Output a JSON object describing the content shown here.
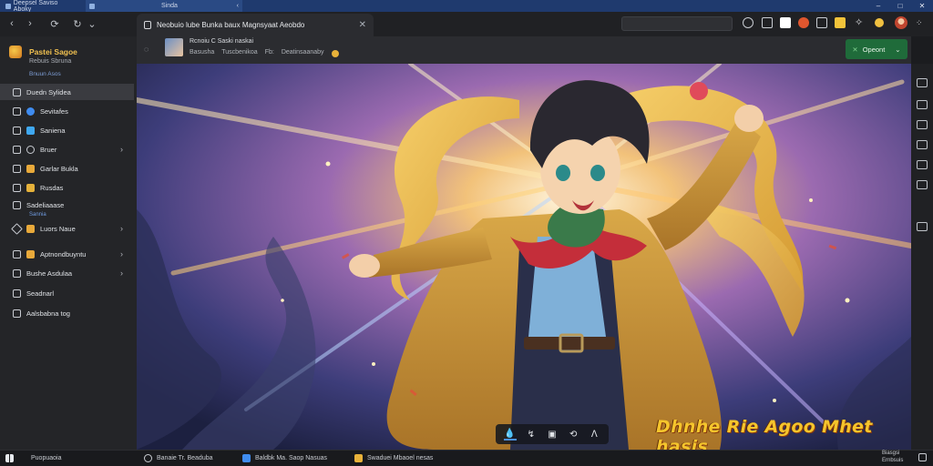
{
  "titlebar": {
    "tabs": [
      {
        "label": "Deepsel Saviso Aboky"
      },
      {
        "label": "Sinda"
      }
    ],
    "controls": [
      "–",
      "□",
      "✕"
    ]
  },
  "toolbar": {
    "nav": [
      "‹",
      "›",
      "⟳",
      "⌄"
    ],
    "active_tab": "Neobuio lube Bunka baux Magnsyaat Aeobdo",
    "close": "✕"
  },
  "sidebar": {
    "brand": {
      "title": "Pastei Sagoe",
      "subtitle": "Rebuis Sbruna",
      "link": "Bnuun Asos"
    },
    "items": [
      {
        "label": "Duedn Sylidea",
        "active": true
      },
      {
        "label": "Sevitafes"
      },
      {
        "label": "Saniena"
      },
      {
        "label": "Bruer",
        "chevron": true
      },
      {
        "label": "Garlar Bukla"
      },
      {
        "label": "Rusdas"
      },
      {
        "label": "Sadeliaaase",
        "sub": "Sannia"
      },
      {
        "label": "Luors Naue",
        "chevron": true
      },
      {
        "label": "Aptnondbuyntu",
        "chevron": true
      },
      {
        "label": "Bushe Asdulaa",
        "chevron": true
      },
      {
        "label": "Seadnarl"
      },
      {
        "label": "Aalsbabna tog"
      }
    ]
  },
  "header": {
    "name": "Rcnoiu C Saski naskai",
    "meta": [
      "Basusha",
      "Tuscbenikoa",
      "Fb:",
      "Deatinsaanaby"
    ],
    "open_label": "Opeont",
    "open_icon": "✕",
    "open_chevron": "⌄",
    "spinner": "◌"
  },
  "artwork": {
    "caption": "Dhnhe Rie Agoo Mhet hasis",
    "media_icons": [
      "💧",
      "↯",
      "▣",
      "⟲",
      "ᐱ"
    ]
  },
  "taskbar": {
    "start_label": "Puopuaoia",
    "items": [
      {
        "label": "Banaie Tr. Beaduba"
      },
      {
        "label": "Baldbk Ma. Saop Nasuas"
      },
      {
        "label": "Swaduei Mbaoel nesas"
      }
    ],
    "tray": {
      "line1": "Biasgsi",
      "line2": "Ernbsuis"
    }
  }
}
